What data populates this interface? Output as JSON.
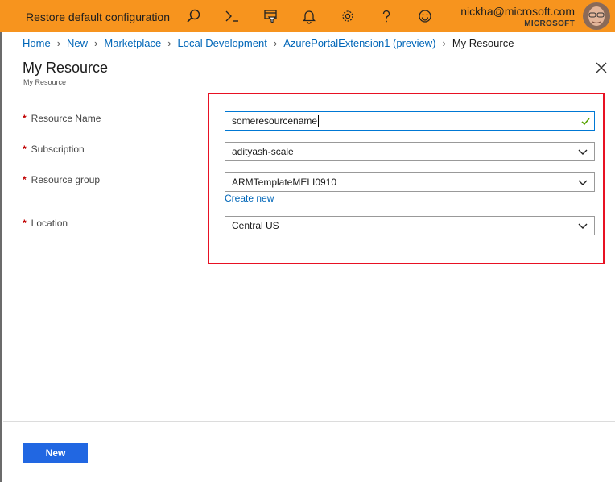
{
  "topbar": {
    "restore_label": "Restore default configuration",
    "icons": [
      "search-icon",
      "cloud-shell-icon",
      "directory-filter-icon",
      "notifications-icon",
      "settings-icon",
      "help-icon",
      "feedback-smiley-icon"
    ],
    "account_email": "nickha@microsoft.com",
    "account_org": "MICROSOFT",
    "accent_color": "#f7941e"
  },
  "breadcrumb": {
    "items": [
      "Home",
      "New",
      "Marketplace",
      "Local Development",
      "AzurePortalExtension1 (preview)"
    ],
    "current": "My Resource"
  },
  "blade": {
    "title": "My Resource",
    "subtitle": "My Resource"
  },
  "form": {
    "required_marker": "*",
    "resource_name": {
      "label": "Resource Name",
      "value": "someresourcename"
    },
    "subscription": {
      "label": "Subscription",
      "value": "adityash-scale"
    },
    "resource_group": {
      "label": "Resource group",
      "value": "ARMTemplateMELI0910",
      "create_new": "Create new"
    },
    "location": {
      "label": "Location",
      "value": "Central US"
    },
    "highlight_color": "#e81123"
  },
  "footer": {
    "new_button": "New",
    "button_color": "#2167e2"
  }
}
